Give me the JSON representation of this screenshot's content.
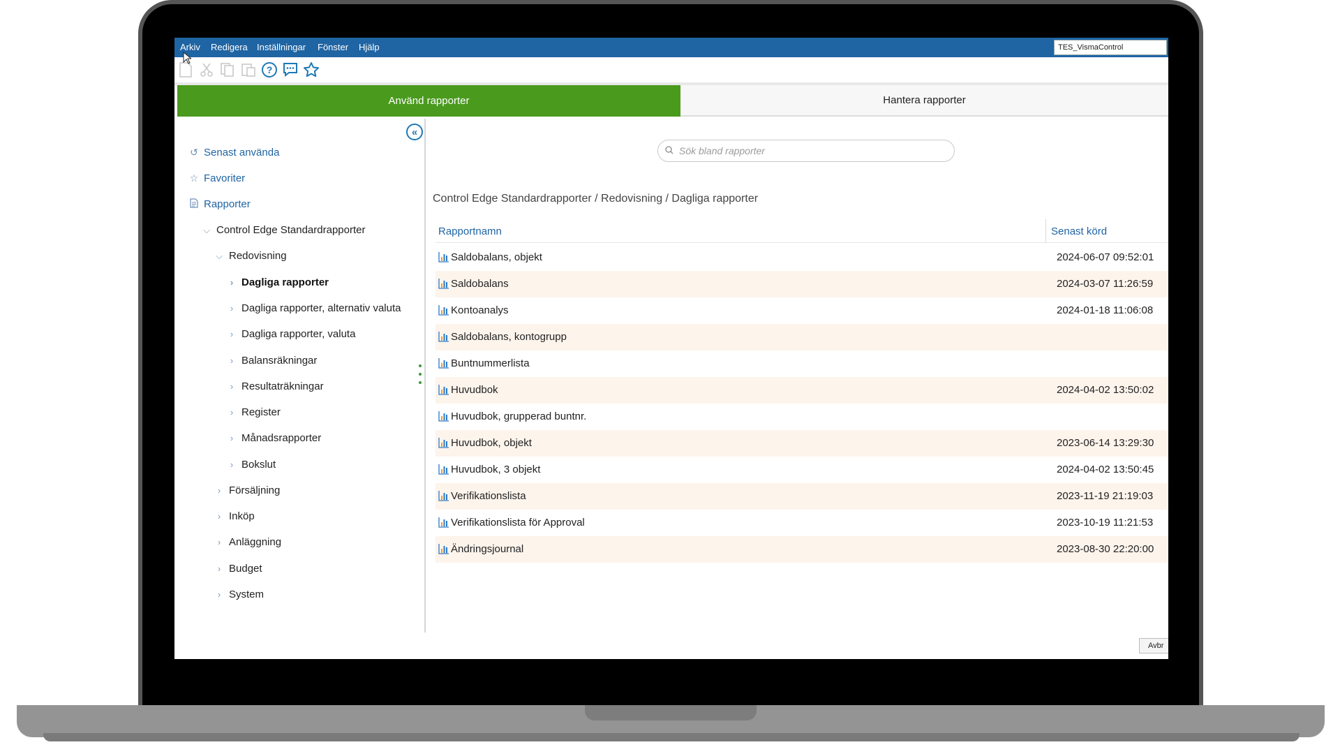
{
  "menubar": {
    "items": [
      "Arkiv",
      "Redigera",
      "Inställningar",
      "Fönster",
      "Hjälp"
    ],
    "company": "TES_VismaControl"
  },
  "toolbar": {
    "icons": [
      "new-document-icon",
      "cut-icon",
      "copy-icon",
      "paste-icon",
      "help-icon",
      "chat-icon",
      "star-icon"
    ]
  },
  "tabs": {
    "use_reports": "Använd rapporter",
    "manage_reports": "Hantera rapporter",
    "active_color": "#4a9a1e"
  },
  "sidebar": {
    "recent": "Senast använda",
    "favorites": "Favoriter",
    "reports": "Rapporter",
    "tree": [
      {
        "label": "Control Edge Standardrapporter",
        "level": 1,
        "expanded": true
      },
      {
        "label": "Redovisning",
        "level": 2,
        "expanded": true
      },
      {
        "label": "Dagliga rapporter",
        "level": 3,
        "selected": true
      },
      {
        "label": "Dagliga rapporter, alternativ valuta",
        "level": 3
      },
      {
        "label": "Dagliga rapporter, valuta",
        "level": 3
      },
      {
        "label": "Balansräkningar",
        "level": 3
      },
      {
        "label": "Resultaträkningar",
        "level": 3
      },
      {
        "label": "Register",
        "level": 3
      },
      {
        "label": "Månadsrapporter",
        "level": 3
      },
      {
        "label": "Bokslut",
        "level": 3
      },
      {
        "label": "Försäljning",
        "level": 2
      },
      {
        "label": "Inköp",
        "level": 2
      },
      {
        "label": "Anläggning",
        "level": 2
      },
      {
        "label": "Budget",
        "level": 2
      },
      {
        "label": "System",
        "level": 2
      }
    ]
  },
  "main": {
    "search_placeholder": "Sök bland rapporter",
    "breadcrumb": "Control Edge Standardrapporter / Redovisning / Dagliga rapporter",
    "columns": {
      "name": "Rapportnamn",
      "last_run": "Senast körd"
    },
    "rows": [
      {
        "name": "Saldobalans, objekt",
        "last_run": "2024-06-07 09:52:01"
      },
      {
        "name": "Saldobalans",
        "last_run": "2024-03-07 11:26:59"
      },
      {
        "name": "Kontoanalys",
        "last_run": "2024-01-18 11:06:08"
      },
      {
        "name": "Saldobalans, kontogrupp",
        "last_run": ""
      },
      {
        "name": "Buntnummerlista",
        "last_run": ""
      },
      {
        "name": "Huvudbok",
        "last_run": "2024-04-02 13:50:02"
      },
      {
        "name": "Huvudbok, grupperad buntnr.",
        "last_run": ""
      },
      {
        "name": "Huvudbok, objekt",
        "last_run": "2023-06-14 13:29:30"
      },
      {
        "name": "Huvudbok, 3 objekt",
        "last_run": "2024-04-02 13:50:45"
      },
      {
        "name": "Verifikationslista",
        "last_run": "2023-11-19 21:19:03"
      },
      {
        "name": "Verifikationslista för Approval",
        "last_run": "2023-10-19 11:21:53"
      },
      {
        "name": "Ändringsjournal",
        "last_run": "2023-08-30 22:20:00"
      }
    ],
    "cancel_label": "Avbr"
  }
}
